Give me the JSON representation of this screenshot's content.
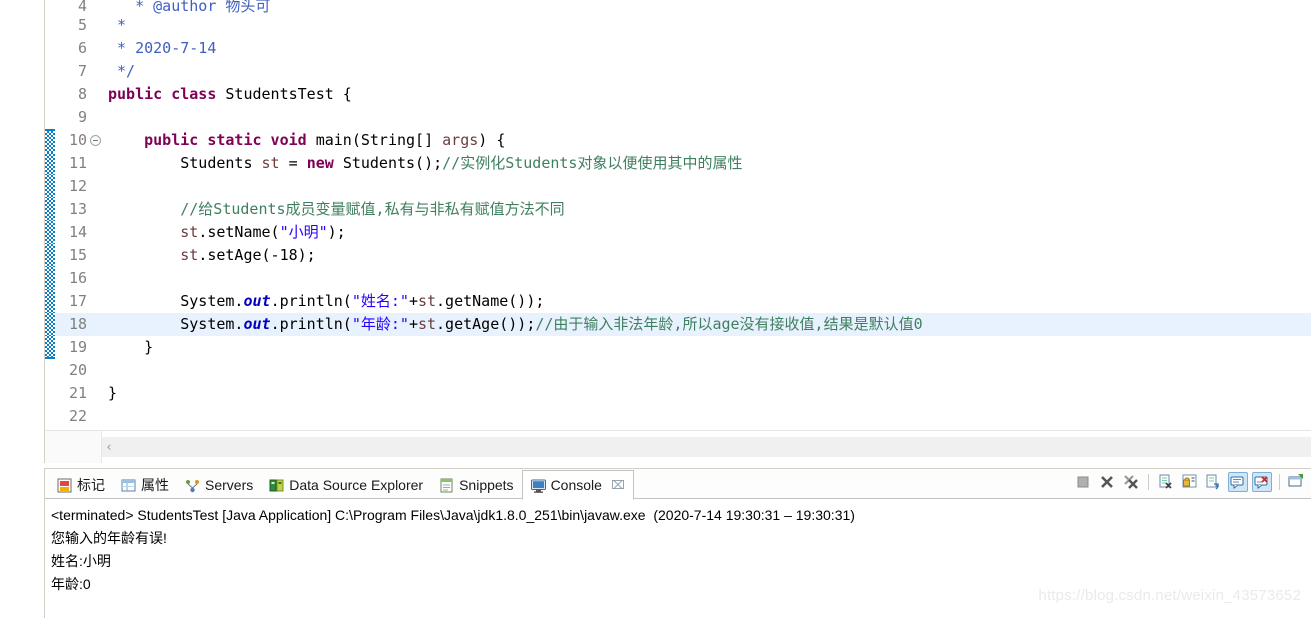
{
  "editor": {
    "lines": [
      {
        "no": "4",
        "clipped": true,
        "fold_bar": false,
        "fold_icon": false,
        "highlight": false,
        "tokens": [
          {
            "t": "   ",
            "c": "plain"
          },
          {
            "t": "* @author ",
            "c": "cmtd"
          },
          {
            "t": "物头可",
            "c": "cmtd"
          }
        ]
      },
      {
        "no": "5",
        "clipped": false,
        "fold_bar": false,
        "fold_icon": false,
        "highlight": false,
        "tokens": [
          {
            "t": " * ",
            "c": "cmtd"
          }
        ]
      },
      {
        "no": "6",
        "clipped": false,
        "fold_bar": false,
        "fold_icon": false,
        "highlight": false,
        "tokens": [
          {
            "t": " * 2020-7-14",
            "c": "cmtd"
          }
        ]
      },
      {
        "no": "7",
        "clipped": false,
        "fold_bar": false,
        "fold_icon": false,
        "highlight": false,
        "tokens": [
          {
            "t": " */",
            "c": "cmtd"
          }
        ]
      },
      {
        "no": "8",
        "clipped": false,
        "fold_bar": false,
        "fold_icon": false,
        "highlight": false,
        "tokens": [
          {
            "t": "public class ",
            "c": "kw"
          },
          {
            "t": "StudentsTest {",
            "c": "plain"
          }
        ]
      },
      {
        "no": "9",
        "clipped": false,
        "fold_bar": false,
        "fold_icon": false,
        "highlight": false,
        "tokens": [
          {
            "t": "",
            "c": "plain"
          }
        ]
      },
      {
        "no": "10",
        "clipped": false,
        "fold_bar": true,
        "fold_bar_cap": "top",
        "fold_icon": true,
        "highlight": false,
        "tokens": [
          {
            "t": "    ",
            "c": "plain"
          },
          {
            "t": "public static void ",
            "c": "kw"
          },
          {
            "t": "main(String[] ",
            "c": "plain"
          },
          {
            "t": "args",
            "c": "var"
          },
          {
            "t": ") {",
            "c": "plain"
          }
        ]
      },
      {
        "no": "11",
        "clipped": false,
        "fold_bar": true,
        "fold_icon": false,
        "highlight": false,
        "tokens": [
          {
            "t": "        Students ",
            "c": "plain"
          },
          {
            "t": "st",
            "c": "var"
          },
          {
            "t": " = ",
            "c": "plain"
          },
          {
            "t": "new ",
            "c": "kw"
          },
          {
            "t": "Students();",
            "c": "plain"
          },
          {
            "t": "//实例化Students对象以便使用其中的属性",
            "c": "cmt"
          }
        ]
      },
      {
        "no": "12",
        "clipped": false,
        "fold_bar": true,
        "fold_icon": false,
        "highlight": false,
        "tokens": [
          {
            "t": "",
            "c": "plain"
          }
        ]
      },
      {
        "no": "13",
        "clipped": false,
        "fold_bar": true,
        "fold_icon": false,
        "highlight": false,
        "tokens": [
          {
            "t": "        ",
            "c": "plain"
          },
          {
            "t": "//给Students成员变量赋值,私有与非私有赋值方法不同",
            "c": "cmt"
          }
        ]
      },
      {
        "no": "14",
        "clipped": false,
        "fold_bar": true,
        "fold_icon": false,
        "highlight": false,
        "tokens": [
          {
            "t": "        ",
            "c": "plain"
          },
          {
            "t": "st",
            "c": "var"
          },
          {
            "t": ".setName(",
            "c": "plain"
          },
          {
            "t": "\"小明\"",
            "c": "str"
          },
          {
            "t": ");",
            "c": "plain"
          }
        ]
      },
      {
        "no": "15",
        "clipped": false,
        "fold_bar": true,
        "fold_icon": false,
        "highlight": false,
        "tokens": [
          {
            "t": "        ",
            "c": "plain"
          },
          {
            "t": "st",
            "c": "var"
          },
          {
            "t": ".setAge(-18);",
            "c": "plain"
          }
        ]
      },
      {
        "no": "16",
        "clipped": false,
        "fold_bar": true,
        "fold_icon": false,
        "highlight": false,
        "tokens": [
          {
            "t": "",
            "c": "plain"
          }
        ]
      },
      {
        "no": "17",
        "clipped": false,
        "fold_bar": true,
        "fold_icon": false,
        "highlight": false,
        "tokens": [
          {
            "t": "        System.",
            "c": "plain"
          },
          {
            "t": "out",
            "c": "fld"
          },
          {
            "t": ".println(",
            "c": "plain"
          },
          {
            "t": "\"姓名:\"",
            "c": "str"
          },
          {
            "t": "+",
            "c": "plain"
          },
          {
            "t": "st",
            "c": "var"
          },
          {
            "t": ".getName());",
            "c": "plain"
          }
        ]
      },
      {
        "no": "18",
        "clipped": false,
        "fold_bar": true,
        "fold_icon": false,
        "highlight": true,
        "tokens": [
          {
            "t": "        System.",
            "c": "plain"
          },
          {
            "t": "out",
            "c": "fld"
          },
          {
            "t": ".println(",
            "c": "plain"
          },
          {
            "t": "\"年龄:\"",
            "c": "str"
          },
          {
            "t": "+",
            "c": "plain"
          },
          {
            "t": "st",
            "c": "var"
          },
          {
            "t": ".getAge());",
            "c": "plain"
          },
          {
            "t": "//由于输入非法年龄,所以age没有接收值,结果是默认值0",
            "c": "cmt"
          }
        ]
      },
      {
        "no": "19",
        "clipped": false,
        "fold_bar": true,
        "fold_bar_cap": "bottom",
        "fold_icon": false,
        "highlight": false,
        "tokens": [
          {
            "t": "    }",
            "c": "plain"
          }
        ]
      },
      {
        "no": "20",
        "clipped": false,
        "fold_bar": false,
        "fold_icon": false,
        "highlight": false,
        "tokens": [
          {
            "t": "",
            "c": "plain"
          }
        ]
      },
      {
        "no": "21",
        "clipped": false,
        "fold_bar": false,
        "fold_icon": false,
        "highlight": false,
        "tokens": [
          {
            "t": "}",
            "c": "plain"
          }
        ]
      },
      {
        "no": "22",
        "clipped": false,
        "fold_bar": false,
        "fold_icon": false,
        "highlight": false,
        "tokens": [
          {
            "t": "",
            "c": "plain"
          }
        ]
      }
    ],
    "hscroll_left_arrow": "‹"
  },
  "console_view": {
    "tabs": [
      {
        "label": "标记",
        "icon": "markers-icon",
        "active": false,
        "closable": false
      },
      {
        "label": "属性",
        "icon": "properties-icon",
        "active": false,
        "closable": false
      },
      {
        "label": "Servers",
        "icon": "servers-icon",
        "active": false,
        "closable": false
      },
      {
        "label": "Data Source Explorer",
        "icon": "data-source-explorer-icon",
        "active": false,
        "closable": false
      },
      {
        "label": "Snippets",
        "icon": "snippets-icon",
        "active": false,
        "closable": false
      },
      {
        "label": "Console",
        "icon": "console-icon",
        "active": true,
        "closable": true,
        "close_glyph": "⌧"
      }
    ],
    "toolbar": [
      {
        "name": "terminate-button",
        "icon": "stop-square-icon",
        "pressed": false
      },
      {
        "name": "remove-launch-button",
        "icon": "remove-x-icon",
        "pressed": false
      },
      {
        "name": "remove-all-terminated-button",
        "icon": "remove-all-xx-icon",
        "pressed": false
      },
      {
        "name": "separator-1",
        "icon": "separator",
        "pressed": false
      },
      {
        "name": "clear-console-button",
        "icon": "clear-console-icon",
        "pressed": false
      },
      {
        "name": "scroll-lock-button",
        "icon": "scroll-lock-icon",
        "pressed": false
      },
      {
        "name": "word-wrap-button",
        "icon": "word-wrap-icon",
        "pressed": false
      },
      {
        "name": "show-console-on-output-button",
        "icon": "show-console-stdout-icon",
        "pressed": true
      },
      {
        "name": "show-console-on-error-button",
        "icon": "show-console-stderr-icon",
        "pressed": true
      },
      {
        "name": "separator-2",
        "icon": "separator",
        "pressed": false
      },
      {
        "name": "open-console-button",
        "icon": "open-console-icon",
        "pressed": false
      }
    ],
    "output": [
      "<terminated> StudentsTest [Java Application] C:\\Program Files\\Java\\jdk1.8.0_251\\bin\\javaw.exe  (2020-7-14 19:30:31 – 19:30:31)",
      "您输入的年龄有误!",
      "姓名:小明",
      "年龄:0"
    ]
  },
  "watermark": "https://blog.csdn.net/weixin_43573652",
  "colors": {
    "keyword": "#7F0055",
    "comment": "#3F7F5F",
    "javadoc": "#3F5FBF",
    "string": "#2A00FF",
    "local_var": "#6A3E3E",
    "static_field": "#0000C0",
    "highlight_line": "#E8F2FE",
    "fold_bar": "#0F7FC4",
    "pressed_toolbar": "#CFE6F7"
  }
}
